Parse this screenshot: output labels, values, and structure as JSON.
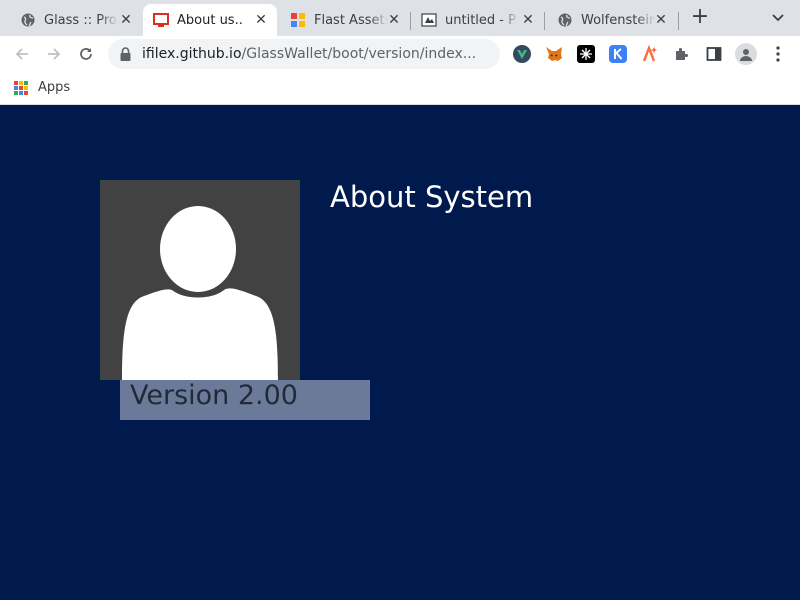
{
  "browser": {
    "tabs": [
      {
        "title": "Glass :: Pro",
        "favicon": "globe-icon",
        "active": false
      },
      {
        "title": "About us..",
        "favicon": "monitor-icon",
        "active": true
      },
      {
        "title": "Flast Assets",
        "favicon": "colorful-squares-icon",
        "active": false
      },
      {
        "title": "untitled - P",
        "favicon": "paint-icon",
        "active": false
      },
      {
        "title": "Wolfenstein",
        "favicon": "globe-icon",
        "active": false
      }
    ],
    "close_glyph": "✕",
    "new_tab_glyph": "+",
    "address": {
      "host": "ifilex.github.io",
      "path": "/GlassWallet/boot/version/index..."
    },
    "extensions": [
      "vue-devtools-icon",
      "metamask-icon",
      "dark-extension-icon",
      "k-extension-icon",
      "sparkle-extension-icon",
      "puzzle-icon",
      "side-panel-icon",
      "profile-icon",
      "kebab-menu-icon"
    ],
    "bookmarks": {
      "apps_label": "Apps"
    }
  },
  "page": {
    "heading": "About System",
    "version": "Version 2.00",
    "avatar": "user-silhouette-icon"
  },
  "colors": {
    "page_bg": "#001a4d",
    "avatar_bg": "#424242",
    "version_bg": "#6b7a99",
    "tabstrip_bg": "#dee1e6"
  }
}
